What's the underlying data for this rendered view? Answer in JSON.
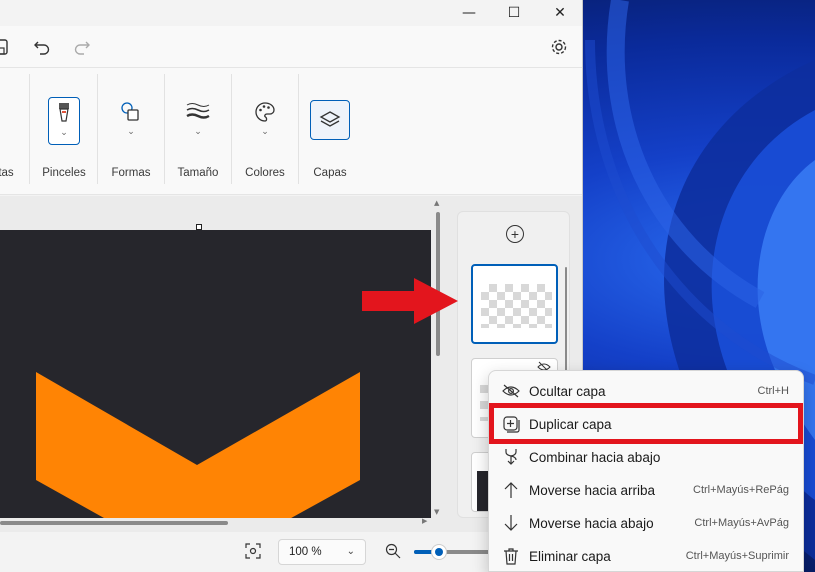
{
  "colors": {
    "accent": "#005fb8",
    "highlight": "#e3151d",
    "canvas_bg": "#26262c",
    "shape": "#ff8404"
  },
  "titlebar": {
    "minimize_glyph": "—",
    "maximize_glyph": "☐",
    "close_glyph": "✕"
  },
  "toolbar": {
    "undo_icon": "undo-icon",
    "redo_icon": "redo-icon",
    "settings_icon": "gear-icon"
  },
  "ribbon": {
    "cut_label": "tas",
    "groups": [
      {
        "label": "Pinceles",
        "icon": "brush-icon",
        "selected": true
      },
      {
        "label": "Formas",
        "icon": "shapes-icon",
        "selected": false
      },
      {
        "label": "Tamaño",
        "icon": "stroke-size-icon",
        "selected": false
      },
      {
        "label": "Colores",
        "icon": "palette-icon",
        "selected": false
      },
      {
        "label": "Capas",
        "icon": "layers-icon",
        "selected": true
      }
    ]
  },
  "statusbar": {
    "zoom_value": "100 %",
    "zoom_fraction": 0.25
  },
  "context_menu": {
    "items": [
      {
        "label": "Ocultar capa",
        "shortcut": "Ctrl+H",
        "icon": "eye-hidden-icon"
      },
      {
        "label": "Duplicar capa",
        "shortcut": "",
        "icon": "duplicate-icon"
      },
      {
        "label": "Combinar hacia abajo",
        "shortcut": "",
        "icon": "merge-down-icon"
      },
      {
        "label": "Moverse hacia arriba",
        "shortcut": "Ctrl+Mayús+RePág",
        "icon": "arrow-up-icon"
      },
      {
        "label": "Moverse hacia abajo",
        "shortcut": "Ctrl+Mayús+AvPág",
        "icon": "arrow-down-icon"
      },
      {
        "label": "Eliminar capa",
        "shortcut": "Ctrl+Mayús+Suprimir",
        "icon": "trash-icon"
      }
    ]
  }
}
